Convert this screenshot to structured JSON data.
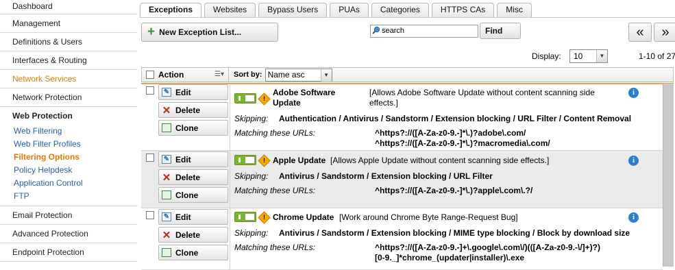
{
  "sidebar": {
    "items_top": [
      "Dashboard",
      "Management",
      "Definitions & Users",
      "Interfaces & Routing",
      "Network Services",
      "Network Protection"
    ],
    "group_title": "Web Protection",
    "sub_items": [
      "Web Filtering",
      "Web Filter Profiles",
      "Filtering Options",
      "Policy Helpdesk",
      "Application Control",
      "FTP"
    ],
    "items_bottom": [
      "Email Protection",
      "Advanced Protection",
      "Endpoint Protection"
    ]
  },
  "tabs": [
    "Exceptions",
    "Websites",
    "Bypass Users",
    "PUAs",
    "Categories",
    "HTTPS CAs",
    "Misc"
  ],
  "toolbar": {
    "new_label": "New Exception List...",
    "search_value": "search",
    "find_label": "Find",
    "prev_label": "«",
    "next_label": "»"
  },
  "display": {
    "label": "Display:",
    "value": "10",
    "range": "1-10 of 27"
  },
  "header": {
    "action_label": "Action",
    "sortby_label": "Sort by:",
    "sort_value": "Name asc"
  },
  "actions": {
    "edit": "Edit",
    "delete": "Delete",
    "clone": "Clone"
  },
  "labels": {
    "skipping": "Skipping:",
    "matching": "Matching these URLs:"
  },
  "rows": [
    {
      "name_1": "Adobe Software",
      "name_2": "Update",
      "desc_1": "[Allows Adobe Software Update without content scanning side",
      "desc_2": "effects.]",
      "skipping": "Authentication / Antivirus / Sandstorm / Extension blocking / URL Filter / Content Removal",
      "url_1": "^https?://([A-Za-z0-9.-]*\\.)?adobe\\.com/",
      "url_2": "^https?://([A-Za-z0-9.-]*\\.)?macromedia\\.com/"
    },
    {
      "name_1": "Apple Update",
      "desc_1": "[Allows Apple Update without content scanning side effects.]",
      "skipping": "Antivirus / Sandstorm / Extension blocking / URL Filter",
      "url_1": "^https?://([A-Za-z0-9.-]*\\.)?apple\\.com\\.?/"
    },
    {
      "name_1": "Chrome Update",
      "desc_1": "[Work around Chrome Byte Range-Request Bug]",
      "skipping": "Antivirus / Sandstorm / Extension blocking / MIME type blocking / Block by download size",
      "url_1": "^https?://([A-Za-z0-9.-]+\\.google\\.com\\/)(([A-Za-z0-9.-\\/]+)?)",
      "url_2": "[0-9._]*chrome_(updater|installer)\\.exe"
    }
  ],
  "colors": {
    "accent_orange": "#e07b00",
    "link_blue": "#2a5db0",
    "toggle_green": "#77b82a",
    "info_blue": "#2a7fd1"
  }
}
